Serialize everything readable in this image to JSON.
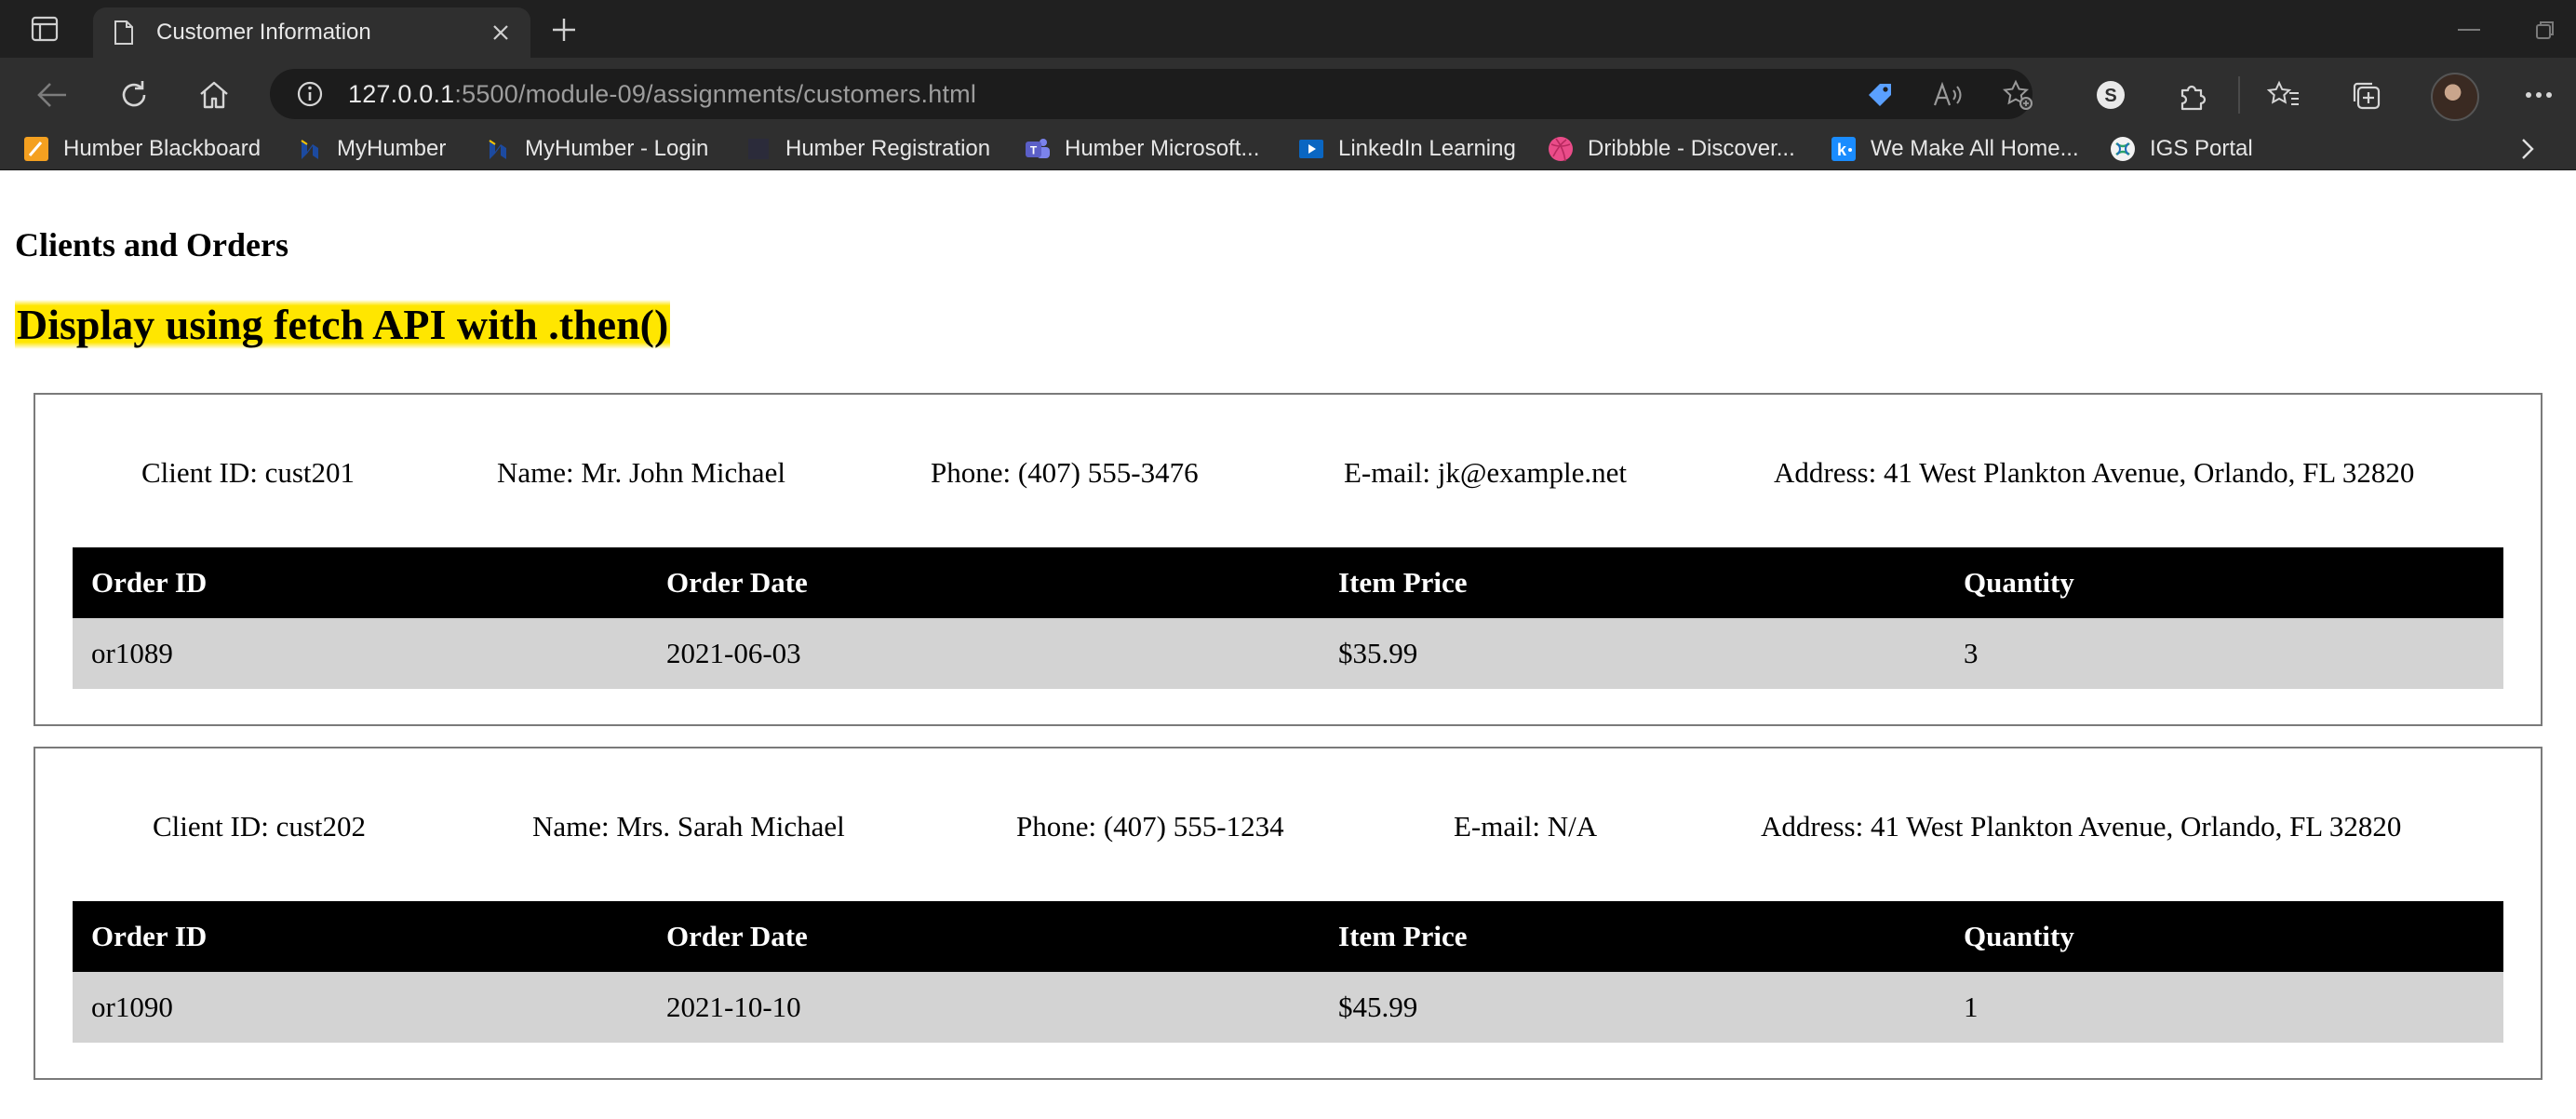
{
  "browser": {
    "tab_title": "Customer Information",
    "url_host": "127.0.0.1",
    "url_path": ":5500/module-09/assignments/customers.html",
    "bookmarks": [
      {
        "label": "Humber Blackboard",
        "icon": "blackboard-icon",
        "color": "#f4a020"
      },
      {
        "label": "MyHumber",
        "icon": "humber-icon",
        "color": "#1c4aa0"
      },
      {
        "label": "MyHumber - Login",
        "icon": "humber-icon",
        "color": "#1c4aa0"
      },
      {
        "label": "Humber Registration",
        "icon": "registration-icon",
        "color": "#2b2b3a"
      },
      {
        "label": "Humber Microsoft...",
        "icon": "teams-icon",
        "color": "#5b5fc7"
      },
      {
        "label": "LinkedIn Learning",
        "icon": "play-icon",
        "color": "#0a66c2"
      },
      {
        "label": "Dribbble - Discover...",
        "icon": "dribbble-icon",
        "color": "#ea4c89"
      },
      {
        "label": "We Make All Home...",
        "icon": "k-icon",
        "color": "#1a8cff"
      },
      {
        "label": "IGS Portal",
        "icon": "igs-icon",
        "color": "#2ca36b"
      }
    ]
  },
  "page": {
    "title": "Clients and Orders",
    "subtitle": "Display using fetch API with .then()",
    "highlight_color": "#ffe600"
  },
  "table_headers": [
    "Order ID",
    "Order Date",
    "Item Price",
    "Quantity"
  ],
  "clients": [
    {
      "client_id": "Client ID: cust201",
      "name": "Name: Mr. John Michael",
      "phone": "Phone: (407) 555-3476",
      "email": "E-mail: jk@example.net",
      "address": "Address: 41 West Plankton Avenue, Orlando, FL 32820",
      "orders": [
        {
          "order_id": "or1089",
          "order_date": "2021-06-03",
          "item_price": "$35.99",
          "quantity": "3"
        }
      ]
    },
    {
      "client_id": "Client ID: cust202",
      "name": "Name: Mrs. Sarah Michael",
      "phone": "Phone: (407) 555-1234",
      "email": "E-mail: N/A",
      "address": "Address: 41 West Plankton Avenue, Orlando, FL 32820",
      "orders": [
        {
          "order_id": "or1090",
          "order_date": "2021-10-10",
          "item_price": "$45.99",
          "quantity": "1"
        }
      ]
    }
  ]
}
